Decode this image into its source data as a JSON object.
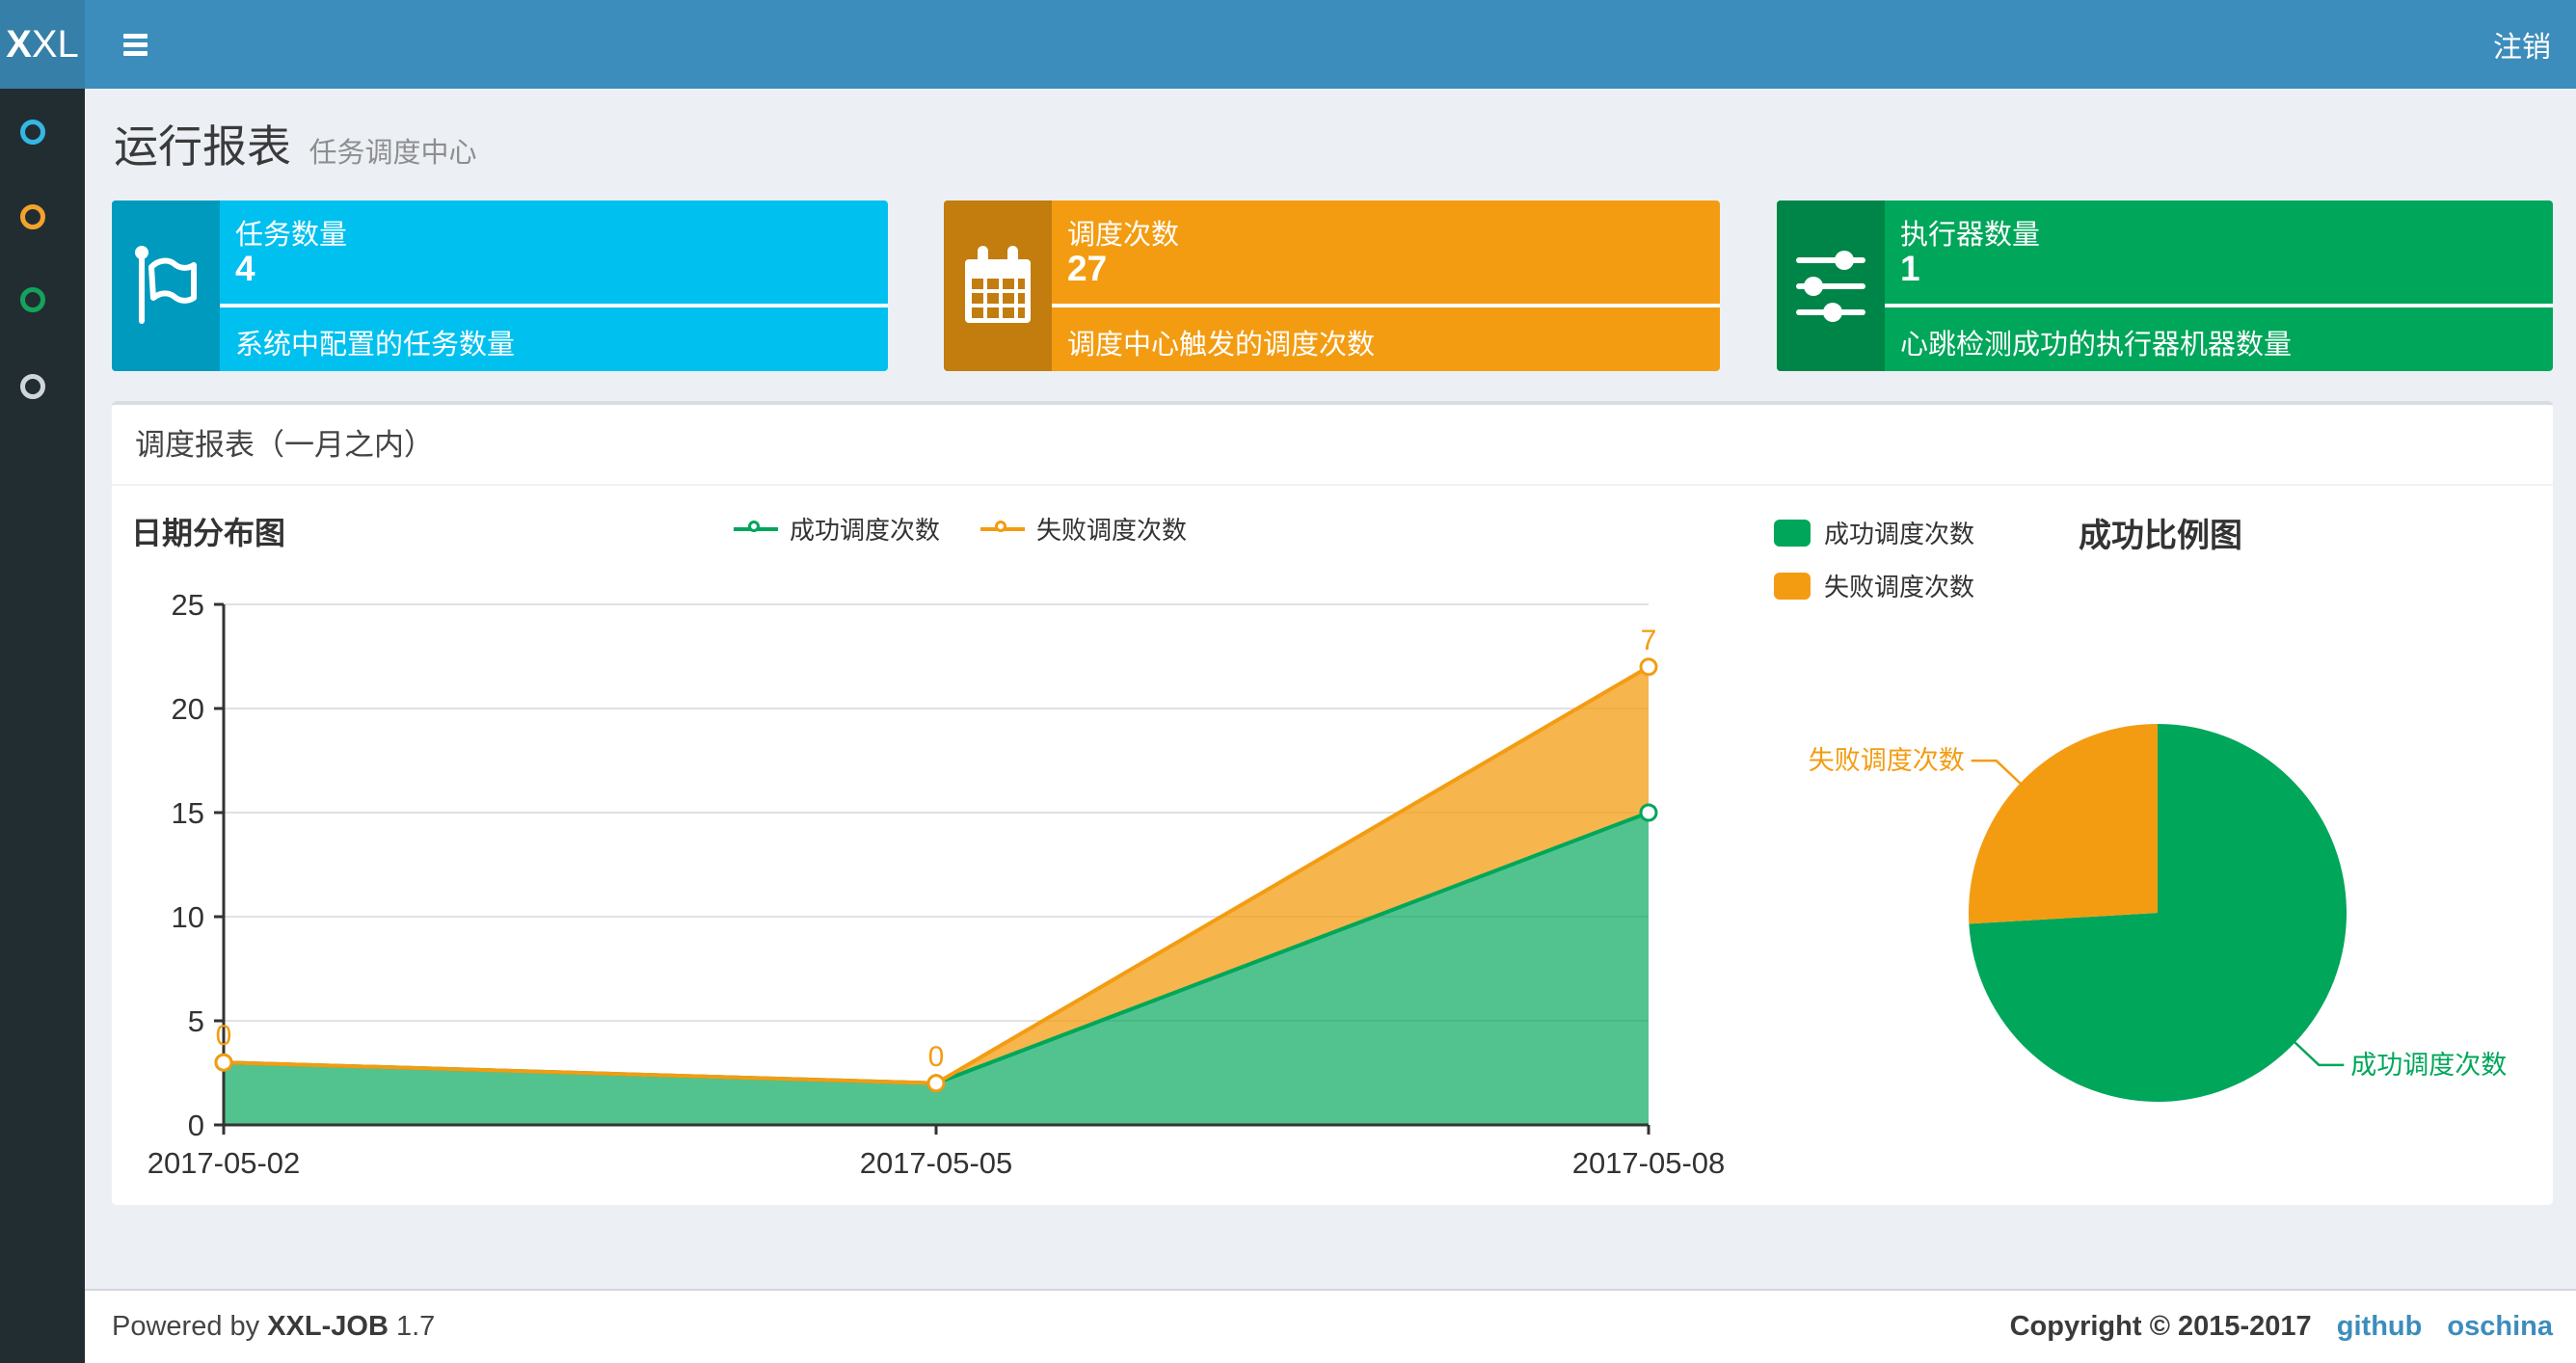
{
  "navbar": {
    "logo_bold": "X",
    "logo_rest": "XL",
    "logout": "注销"
  },
  "theme": {
    "navbar_bg": "#3c8dbc",
    "logo_bg": "#367fa9",
    "sidebar_bg": "#222d32",
    "page_bg": "#ecf0f5",
    "panel_bg": "#ffffff",
    "link_color": "#3c8dbc",
    "success_color": "#00a65a",
    "fail_color": "#f39c12"
  },
  "sidebar": {
    "items": [
      {
        "icon": "circle-outline-icon",
        "color": "#34b7e4"
      },
      {
        "icon": "circle-outline-icon",
        "color": "#f3a22c"
      },
      {
        "icon": "circle-outline-icon",
        "color": "#14a35c"
      },
      {
        "icon": "circle-outline-icon",
        "color": "#d0d5da"
      }
    ]
  },
  "header": {
    "title": "运行报表",
    "subtitle": "任务调度中心"
  },
  "stats": [
    {
      "icon": "flag-icon",
      "label": "任务数量",
      "value": "4",
      "desc": "系统中配置的任务数量",
      "color": "#00c0ef",
      "icon_bg": "#009abf"
    },
    {
      "icon": "calendar-icon",
      "label": "调度次数",
      "value": "27",
      "desc": "调度中心触发的调度次数",
      "color": "#f39c12",
      "icon_bg": "#c27d0e"
    },
    {
      "icon": "sliders-icon",
      "label": "执行器数量",
      "value": "1",
      "desc": "心跳检测成功的执行器机器数量",
      "color": "#00a65a",
      "icon_bg": "#008548"
    }
  ],
  "panel": {
    "title": "调度报表（一月之内）"
  },
  "chart_data": [
    {
      "type": "area",
      "title": "日期分布图",
      "x": [
        "2017-05-02",
        "2017-05-05",
        "2017-05-08"
      ],
      "series": [
        {
          "name": "成功调度次数",
          "values": [
            3,
            2,
            15
          ],
          "color": "#00a65a",
          "area_fill": "rgba(0,166,90,0.68)"
        },
        {
          "name": "失败调度次数",
          "values": [
            0,
            0,
            7
          ],
          "color": "#f39c12",
          "area_fill": "rgba(243,156,18,0.75)",
          "point_labels": [
            "0",
            "0",
            "7"
          ]
        }
      ],
      "stacked": true,
      "xlabel": "",
      "ylabel": "",
      "ylim": [
        0,
        25
      ],
      "yticks": [
        0,
        5,
        10,
        15,
        20,
        25
      ],
      "grid": true,
      "legend_position": "top"
    },
    {
      "type": "pie",
      "title": "成功比例图",
      "slices": [
        {
          "label": "成功调度次数",
          "value": 20,
          "color": "#00a65a"
        },
        {
          "label": "失败调度次数",
          "value": 7,
          "color": "#f39c12"
        }
      ],
      "start_angle": 90,
      "legend_position": "left"
    }
  ],
  "footer": {
    "powered_prefix": "Powered by",
    "product": "XXL-JOB",
    "version": "1.7",
    "copyright": "Copyright © 2015-2017",
    "links": [
      {
        "label": "github"
      },
      {
        "label": "oschina"
      }
    ]
  }
}
